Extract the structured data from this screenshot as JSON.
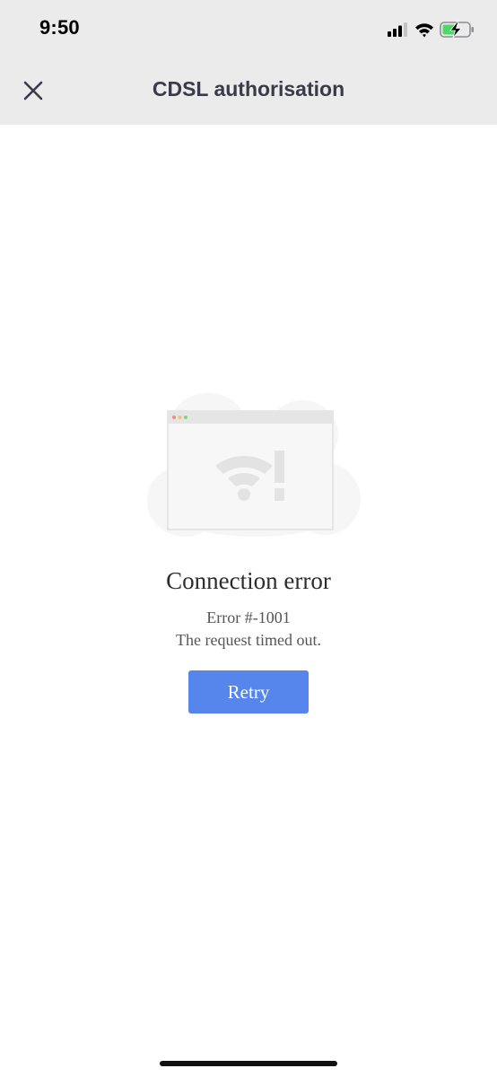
{
  "status_bar": {
    "time": "9:50",
    "icons": [
      "cellular-signal-icon",
      "wifi-icon",
      "battery-charging-icon"
    ]
  },
  "header": {
    "title": "CDSL authorisation",
    "close_icon": "close-icon"
  },
  "error": {
    "illustration_icon": "no-connection-browser-icon",
    "title": "Connection error",
    "code": "Error #-1001",
    "message": "The request timed out."
  },
  "actions": {
    "retry_label": "Retry"
  },
  "colors": {
    "header_background": "#ebebeb",
    "title_text": "#3a3a48",
    "retry_button": "#5686ec",
    "battery_charging": "#4cd964"
  }
}
